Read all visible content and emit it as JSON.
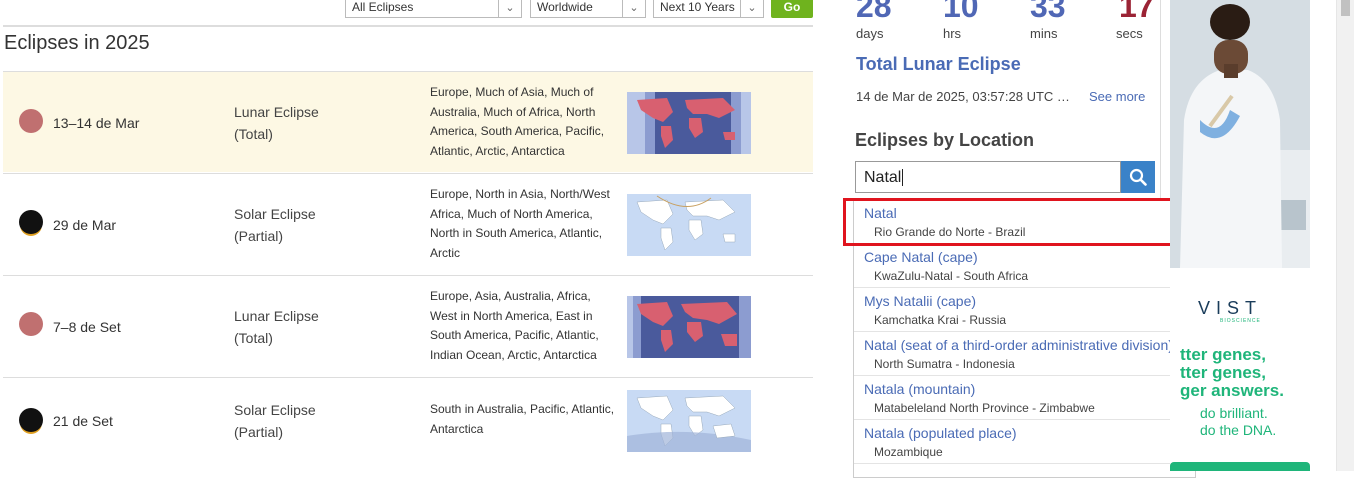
{
  "filters": {
    "type": "All Eclipses",
    "region": "Worldwide",
    "period": "Next 10 Years",
    "go_label": "Go"
  },
  "page_title": "Eclipses in 2025",
  "eclipses": [
    {
      "date": "13–14 de Mar",
      "kind": "Lunar Eclipse",
      "subtype": "(Total)",
      "icon": "lunar-eclipse-icon",
      "visibility": "Europe, Much of Asia, Much of Australia, Much of Africa, North America, South America, Pacific, Atlantic, Arctic, Antarctica"
    },
    {
      "date": "29 de Mar",
      "kind": "Solar Eclipse",
      "subtype": "(Partial)",
      "icon": "solar-eclipse-icon",
      "visibility": "Europe, North in Asia, North/West Africa, Much of North America, North in South America, Atlantic, Arctic"
    },
    {
      "date": "7–8 de Set",
      "kind": "Lunar Eclipse",
      "subtype": "(Total)",
      "icon": "lunar-eclipse-icon",
      "visibility": "Europe, Asia, Australia, Africa, West in North America, East in South America, Pacific, Atlantic, Indian Ocean, Arctic, Antarctica"
    },
    {
      "date": "21 de Set",
      "kind": "Solar Eclipse",
      "subtype": "(Partial)",
      "icon": "solar-eclipse-icon",
      "visibility": "South in Australia, Pacific, Atlantic, Antarctica"
    }
  ],
  "countdown": {
    "days": "28",
    "hrs": "10",
    "mins": "33",
    "secs": "17",
    "days_label": "days",
    "hrs_label": "hrs",
    "mins_label": "mins",
    "secs_label": "secs"
  },
  "next_eclipse": {
    "title": "Total Lunar Eclipse",
    "datetime": "14 de Mar de 2025, 03:57:28 UTC …",
    "see_more": "See more"
  },
  "location_search": {
    "heading": "Eclipses by Location",
    "value": "Natal"
  },
  "suggestions": [
    {
      "name": "Natal",
      "region": "Rio Grande do Norte - Brazil",
      "flag": "brazil-flag-icon"
    },
    {
      "name": "Cape Natal (cape)",
      "region": "KwaZulu-Natal - South Africa",
      "flag": "south-africa-flag-icon"
    },
    {
      "name": "Mys Natalii (cape)",
      "region": "Kamchatka Krai - Russia",
      "flag": "russia-flag-icon"
    },
    {
      "name": "Natal (seat of a third-order administrative division)",
      "region": "North Sumatra - Indonesia",
      "flag": "indonesia-flag-icon"
    },
    {
      "name": "Natala (mountain)",
      "region": "Matabeleland North Province - Zimbabwe",
      "flag": "zimbabwe-flag-icon"
    },
    {
      "name": "Natala (populated place)",
      "region": "Mozambique",
      "flag": "mozambique-flag-icon"
    }
  ],
  "ad": {
    "logo": "VIST",
    "logo_sub": "BIOSCIENCE",
    "line1": "tter genes,",
    "line2": "tter genes,",
    "line3": "ger answers.",
    "line4": "do brilliant.",
    "line5": "do the DNA."
  },
  "colors": {
    "link": "#4a6bb5",
    "countdown": "#5067b5",
    "secs": "#9b2335",
    "go_button": "#6fb31e",
    "highlight_box": "#e0141e",
    "ad_green": "#1fb57a"
  }
}
